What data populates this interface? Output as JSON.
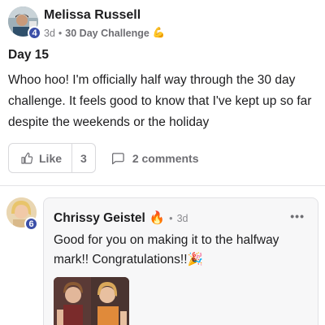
{
  "post": {
    "author_name": "Melissa Russell",
    "author_level": "4",
    "time": "3d",
    "separator": "•",
    "category": "30 Day Challenge",
    "category_emoji": "💪",
    "title": "Day 15",
    "body": "Whoo hoo! I'm officially half way through the 30 day challenge. It feels good to know that I've kept up so far despite the weekends or the holiday"
  },
  "actions": {
    "like_label": "Like",
    "like_count": "3",
    "comments_label": "2 comments"
  },
  "comment": {
    "author_name": "Chrissy Geistel",
    "author_emoji": "🔥",
    "author_level": "6",
    "separator": "•",
    "time": "3d",
    "more_label": "•••",
    "text": "Good for you on making it to the halfway mark!! Congratulations!!🎉"
  },
  "colors": {
    "level_badge": "#3b4fa8",
    "muted_text": "#6e6e73",
    "border": "#d9d9dc",
    "comment_bg": "#f7f7f8"
  }
}
